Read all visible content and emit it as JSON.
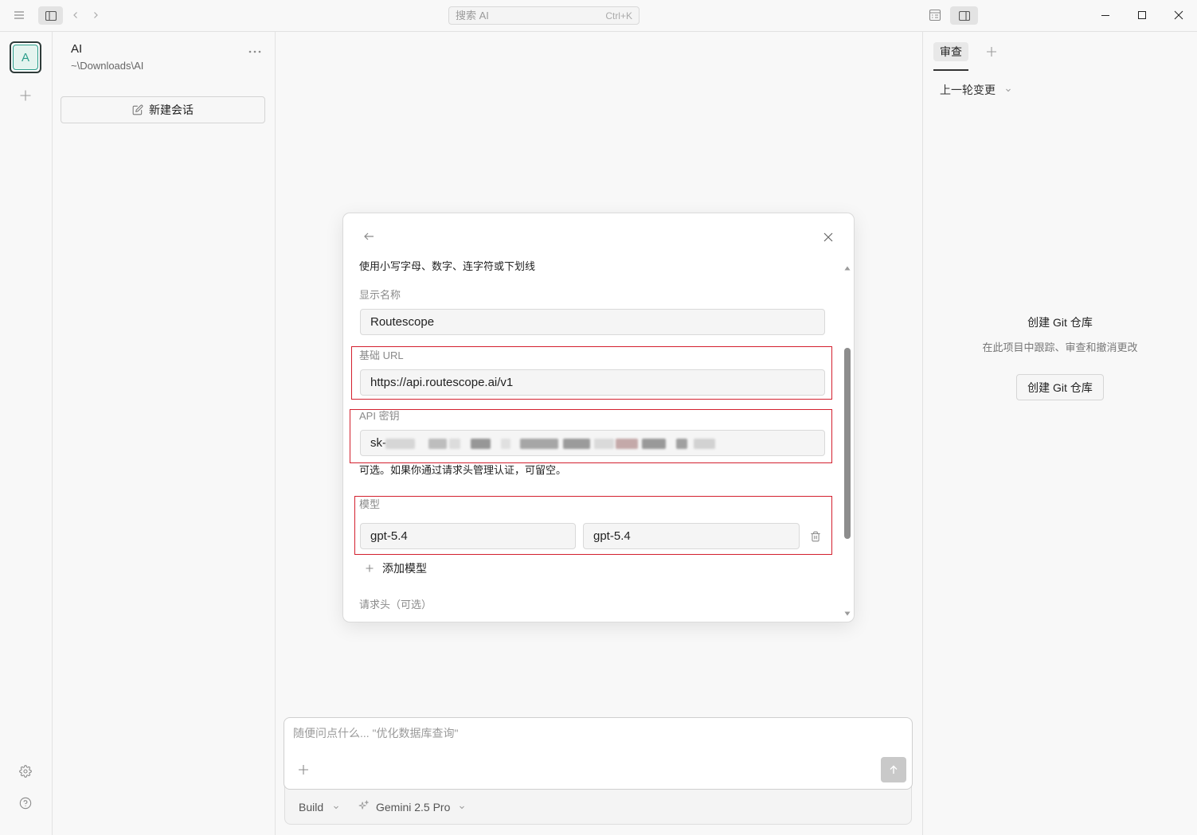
{
  "window": {
    "search_placeholder": "搜索 AI",
    "search_shortcut": "Ctrl+K"
  },
  "rail": {
    "avatar_letter": "A"
  },
  "sidebar": {
    "project_name": "AI",
    "project_path": "~\\Downloads\\AI",
    "new_chat_label": "新建会话"
  },
  "dialog": {
    "id_hint": "使用小写字母、数字、连字符或下划线",
    "display_name": {
      "label": "显示名称",
      "value": "Routescope"
    },
    "base_url": {
      "label": "基础 URL",
      "value": "https://api.routescope.ai/v1"
    },
    "api_key": {
      "label": "API 密钥",
      "visible_prefix": "sk-",
      "redacted": true,
      "hint": "可选。如果你通过请求头管理认证，可留空。"
    },
    "models": {
      "label": "模型",
      "rows": [
        {
          "id": "gpt-5.4",
          "name": "gpt-5.4"
        }
      ],
      "add_label": "添加模型"
    },
    "headers_label": "请求头（可选）"
  },
  "composer": {
    "placeholder": "随便问点什么... \"优化数据库查询\"",
    "mode": "Build",
    "model": "Gemini 2.5 Pro"
  },
  "review_panel": {
    "tab_label": "审查",
    "changes_filter": "上一轮变更",
    "empty_title": "创建 Git 仓库",
    "empty_description": "在此项目中跟踪、审查和撤消更改",
    "create_button_label": "创建 Git 仓库"
  },
  "icons": {
    "titlebar": [
      "menu-icon",
      "sidebar-left-icon",
      "chevron-left-icon",
      "chevron-right-icon",
      "panel-layout-icon",
      "sidebar-right-icon",
      "minimize-icon",
      "maximize-icon",
      "close-icon"
    ],
    "rail": [
      "plus-icon",
      "gear-icon",
      "help-icon"
    ],
    "sidebar": [
      "more-icon",
      "edit-icon"
    ],
    "dialog": [
      "arrow-left-icon",
      "close-icon",
      "trash-icon",
      "plus-icon"
    ],
    "composer": [
      "plus-icon",
      "arrow-up-icon",
      "chevron-down-icon",
      "sparkle-icon"
    ],
    "review_panel": [
      "plus-icon",
      "chevron-down-icon"
    ]
  },
  "colors": {
    "accent": "#2a9d8a",
    "annotation": "#d3202e",
    "send_button": "#c9c9c9"
  }
}
